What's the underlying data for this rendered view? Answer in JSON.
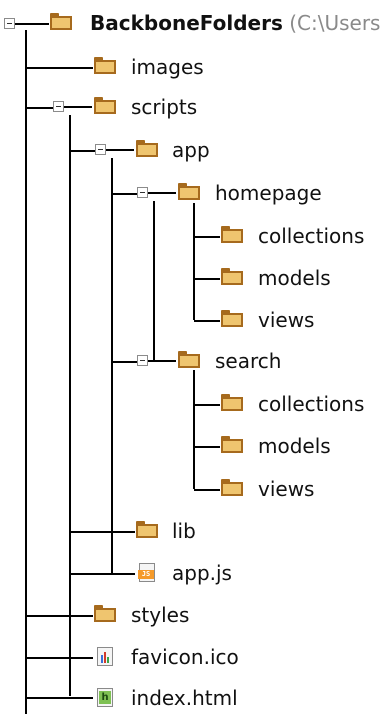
{
  "tree": {
    "root": {
      "name": "BackboneFolders",
      "path": "(C:\\Users"
    },
    "nodes": [
      {
        "id": "images",
        "label": "images",
        "type": "folder"
      },
      {
        "id": "scripts",
        "label": "scripts",
        "type": "folder",
        "expanded": true
      },
      {
        "id": "app",
        "label": "app",
        "type": "folder",
        "expanded": true
      },
      {
        "id": "homepage",
        "label": "homepage",
        "type": "folder",
        "expanded": true
      },
      {
        "id": "homepage-collections",
        "label": "collections",
        "type": "folder"
      },
      {
        "id": "homepage-models",
        "label": "models",
        "type": "folder"
      },
      {
        "id": "homepage-views",
        "label": "views",
        "type": "folder"
      },
      {
        "id": "search",
        "label": "search",
        "type": "folder",
        "expanded": true
      },
      {
        "id": "search-collections",
        "label": "collections",
        "type": "folder"
      },
      {
        "id": "search-models",
        "label": "models",
        "type": "folder"
      },
      {
        "id": "search-views",
        "label": "views",
        "type": "folder"
      },
      {
        "id": "lib",
        "label": "lib",
        "type": "folder"
      },
      {
        "id": "app-js",
        "label": "app.js",
        "type": "js-file",
        "icon": "javascript-file-icon"
      },
      {
        "id": "styles",
        "label": "styles",
        "type": "folder"
      },
      {
        "id": "favicon",
        "label": "favicon.ico",
        "type": "ico-file",
        "icon": "image-file-icon"
      },
      {
        "id": "index-html",
        "label": "index.html",
        "type": "html-file",
        "icon": "html-file-icon"
      }
    ]
  },
  "colors": {
    "folder_fill": "#efc56f",
    "folder_edge": "#a66a1d",
    "tree_line": "#000000",
    "root_path_text": "#8a8a8a",
    "js_badge": "#f59a2a",
    "html_badge": "#7ec153"
  }
}
